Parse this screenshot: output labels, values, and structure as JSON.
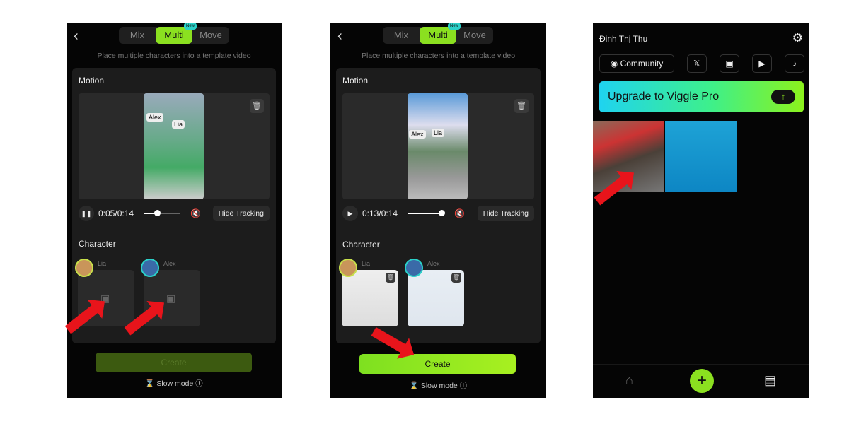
{
  "tabs": [
    "Mix",
    "Multi",
    "Move"
  ],
  "new_badge": "New",
  "subtitle": "Place multiple characters into a template video",
  "motion_label": "Motion",
  "character_label": "Character",
  "hide_tracking": "Hide Tracking",
  "create": "Create",
  "slow_mode": "Slow mode",
  "char_names": [
    "Lia",
    "Alex"
  ],
  "screen1": {
    "time": "0:05/0:14",
    "progress": 0.36,
    "playing": true,
    "create_enabled": false
  },
  "screen2": {
    "time": "0:13/0:14",
    "progress": 0.93,
    "playing": false,
    "create_enabled": true
  },
  "profile": {
    "name": "Đinh Thị Thu",
    "community": "Community",
    "upgrade": "Upgrade to Viggle Pro"
  },
  "colors": {
    "accent": "#8be020",
    "arrow": "#e8141b"
  }
}
